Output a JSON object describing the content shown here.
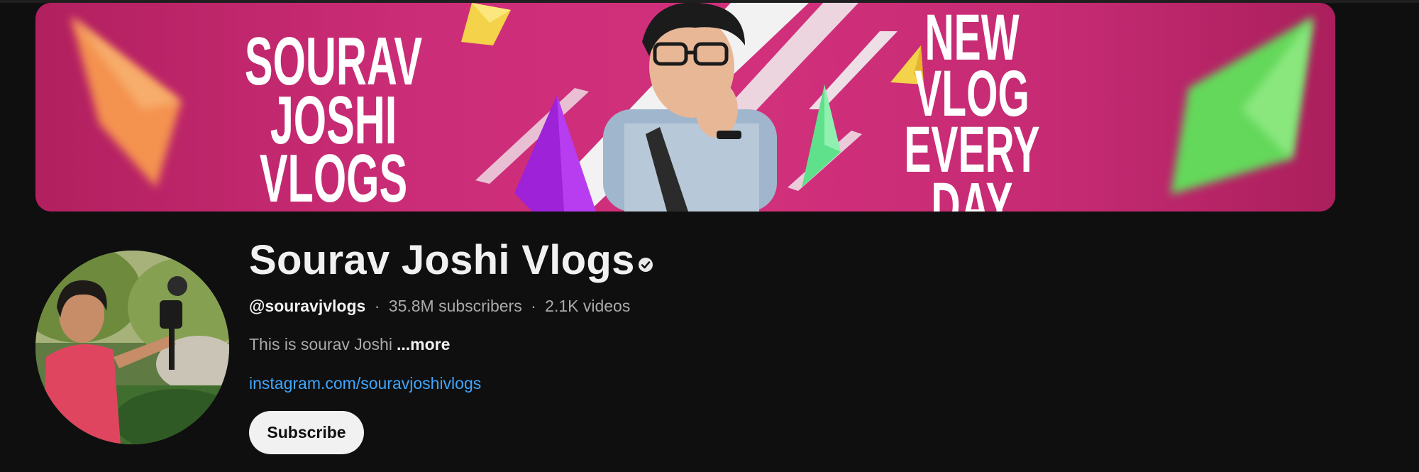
{
  "banner": {
    "left_text": [
      "SOURAV",
      "JOSHI",
      "VLOGS"
    ],
    "right_text": [
      "NEW",
      "VLOG",
      "EVERY",
      "DAY"
    ]
  },
  "channel": {
    "name": "Sourav Joshi Vlogs",
    "verified_icon": "verified-check-icon",
    "handle": "@souravjvlogs",
    "separator": "·",
    "subscribers": "35.8M subscribers",
    "videos": "2.1K videos",
    "description": "This is sourav Joshi",
    "more_label": "...more",
    "link_text": "instagram.com/souravjoshivlogs"
  },
  "actions": {
    "subscribe_label": "Subscribe"
  },
  "colors": {
    "background": "#0f0f0f",
    "banner_magenta": "#cc2d78",
    "link_blue": "#3ea6ff",
    "subscribe_bg": "#f1f1f1"
  }
}
